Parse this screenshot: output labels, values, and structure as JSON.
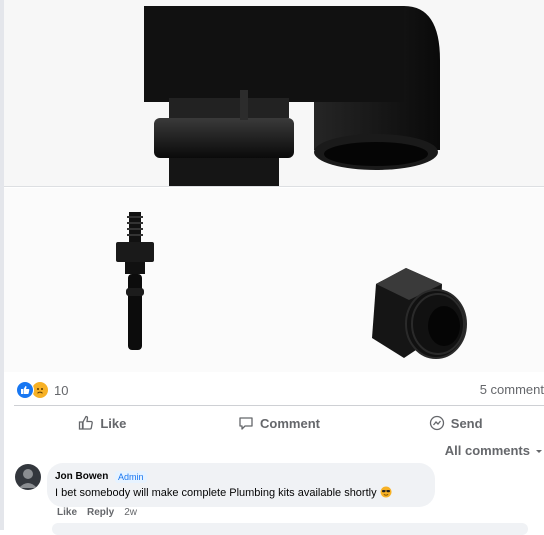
{
  "post": {
    "reaction_count": "10",
    "comments_count": "5 comment"
  },
  "actions": {
    "like_label": "Like",
    "comment_label": "Comment",
    "send_label": "Send"
  },
  "sort_label": "All comments",
  "comment": {
    "author": "Jon Bowen",
    "badge": "Admin",
    "text": "I bet somebody will make complete Plumbing kits available shortly",
    "like_label": "Like",
    "reply_label": "Reply",
    "time": "2w"
  },
  "colors": {
    "accent": "#1877f2",
    "muted": "#65676b",
    "bubble": "#f0f2f5"
  },
  "icons": [
    "like-reaction-icon",
    "sad-reaction-icon",
    "thumbs-up-icon",
    "comment-icon",
    "send-icon",
    "chevron-down-icon",
    "sunglasses-emoji-icon"
  ]
}
